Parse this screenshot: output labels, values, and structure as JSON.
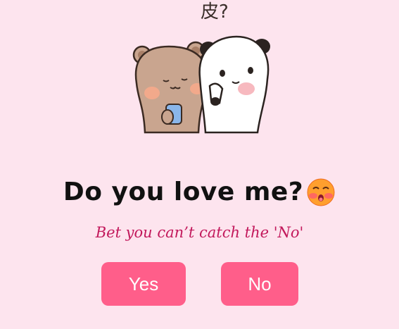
{
  "sticker": {
    "caption": "皮?",
    "icon": "bear-and-panda-sticker"
  },
  "heading": {
    "title": "Do you love me?",
    "emoji_icon": "blushing-kiss-face-emoji"
  },
  "subtitle": "Bet you can’t catch the 'No'",
  "buttons": {
    "yes_label": "Yes",
    "no_label": "No"
  },
  "colors": {
    "background": "#fde4ee",
    "button": "#ff5e8a",
    "subtitle": "#c2185b"
  }
}
